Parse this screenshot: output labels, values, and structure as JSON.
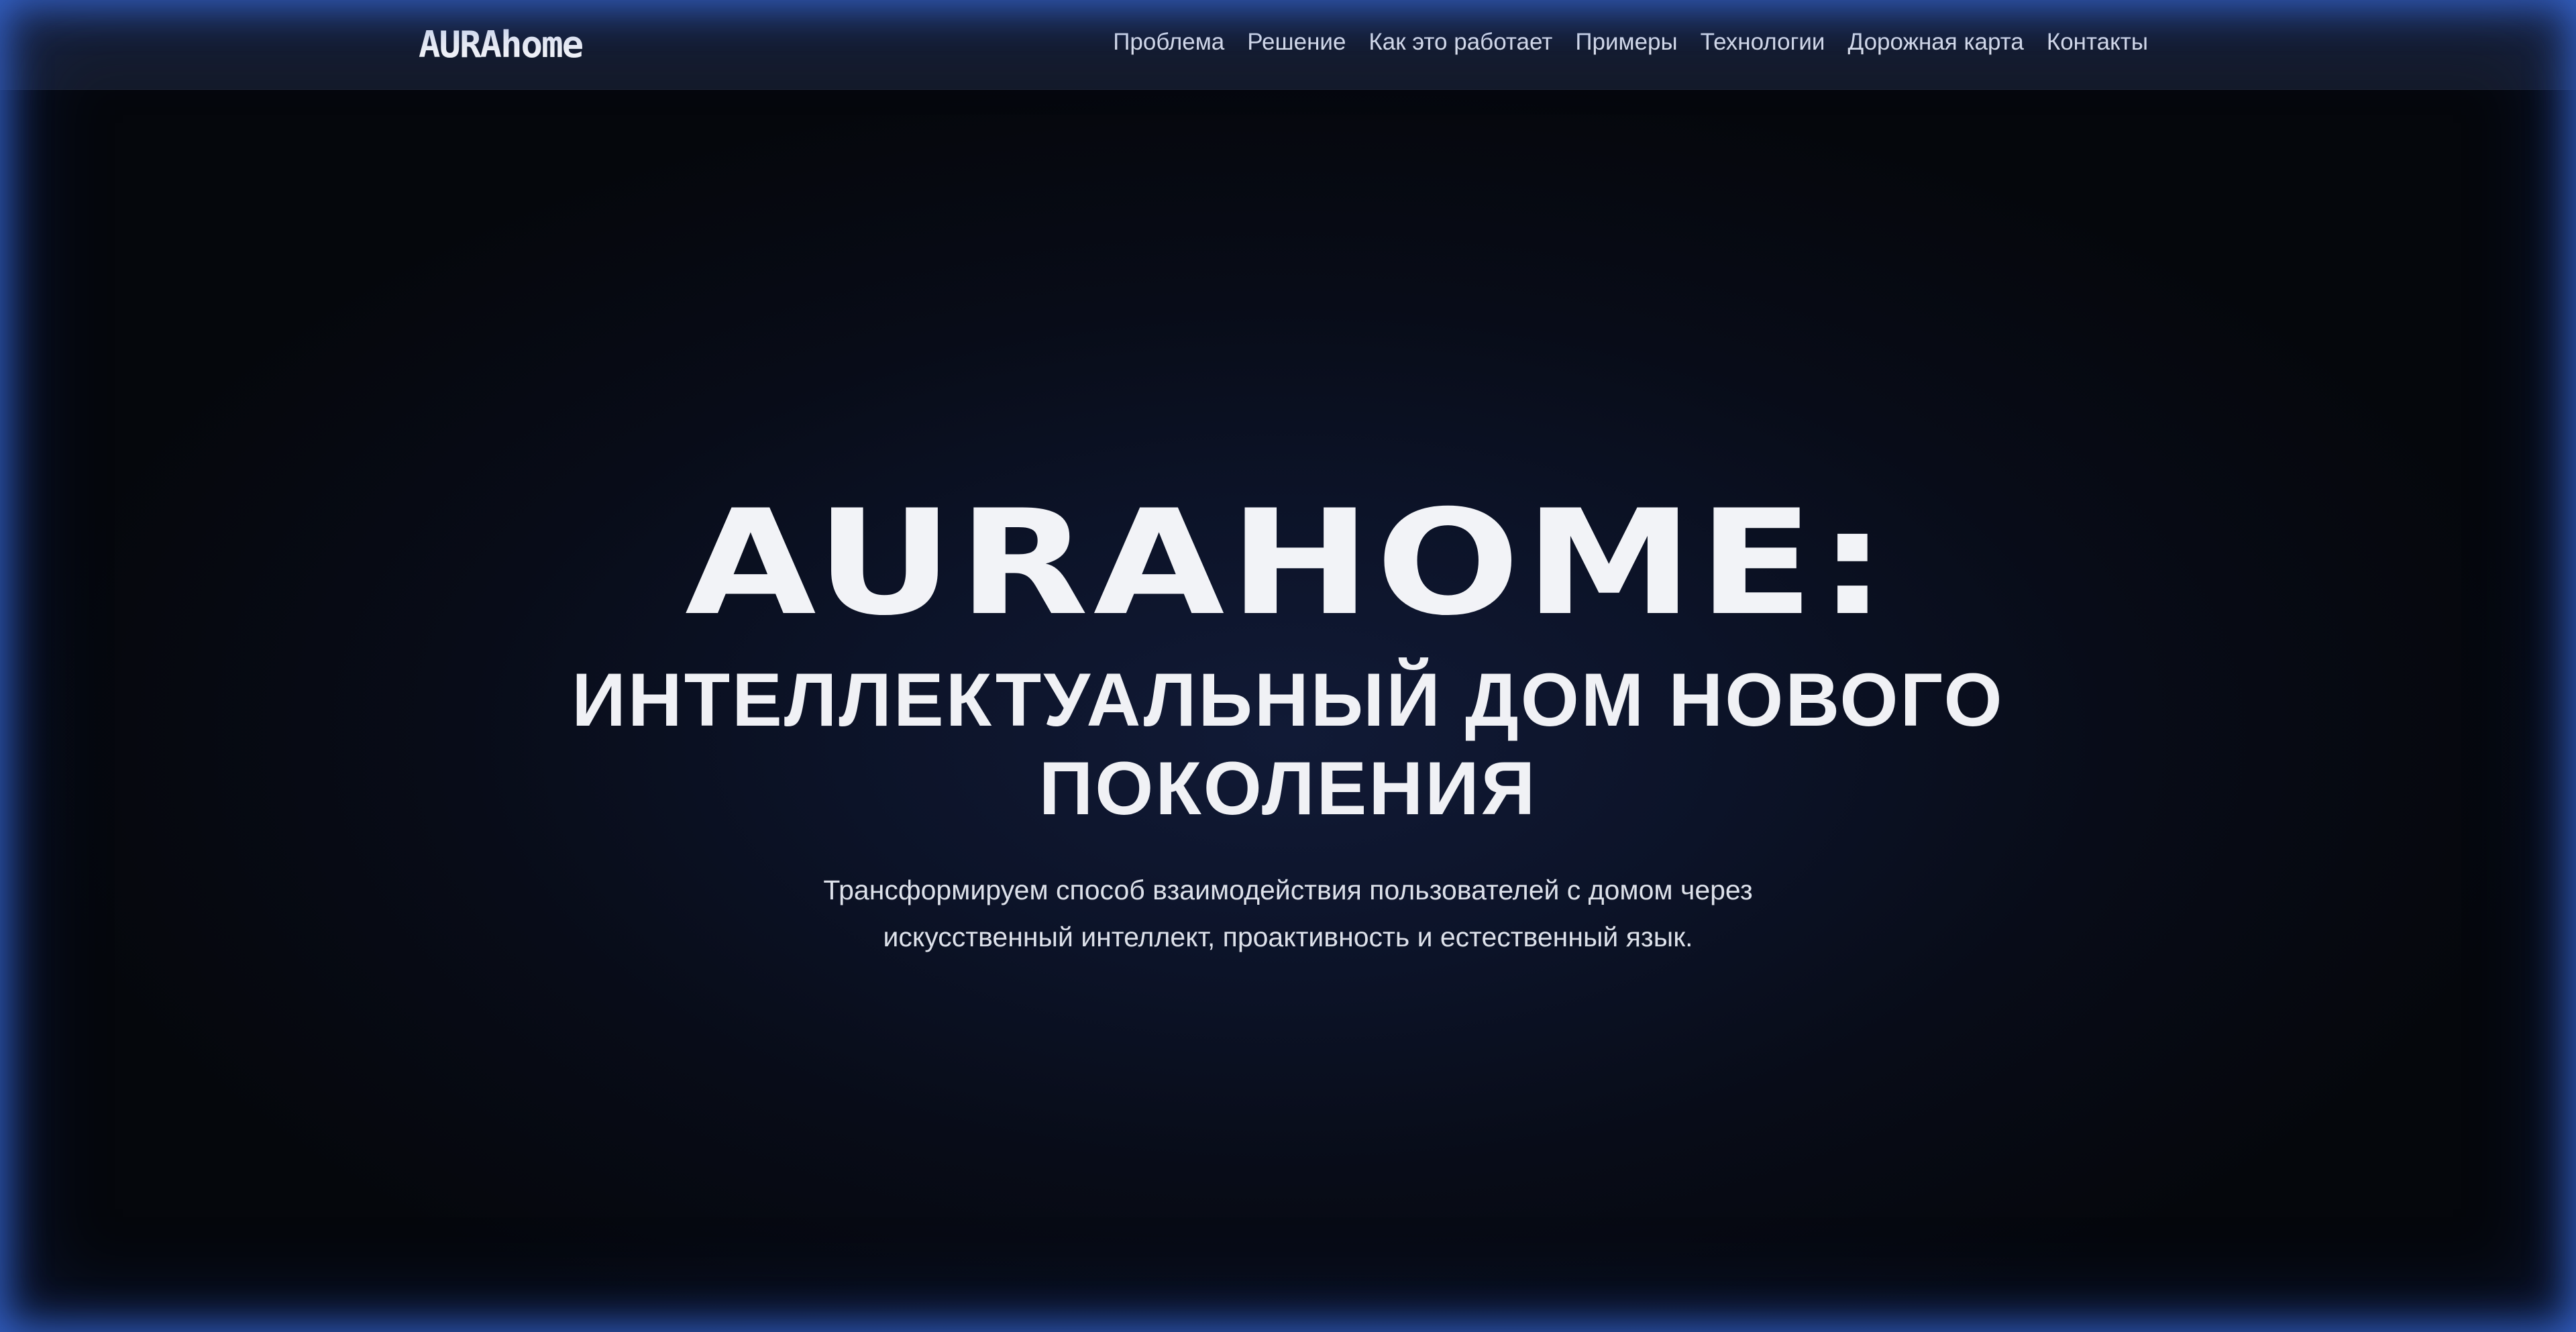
{
  "nav": {
    "logo": "AURAhome",
    "links": [
      "Проблема",
      "Решение",
      "Как это работает",
      "Примеры",
      "Технологии",
      "Дорожная карта",
      "Контакты"
    ]
  },
  "hero": {
    "title": "AURAHOME:",
    "subtitle": "ИНТЕЛЛЕКТУАЛЬНЫЙ ДОМ НОВОГО ПОКОЛЕНИЯ",
    "description": "Трансформируем способ взаимодействия пользователей с домом через искусственный интеллект, проактивность и естественный язык."
  },
  "colors": {
    "background": "#080c18",
    "navbar": "#161c2c",
    "edge_glow": "#3a6cdc",
    "text": "#f2f3f7"
  }
}
